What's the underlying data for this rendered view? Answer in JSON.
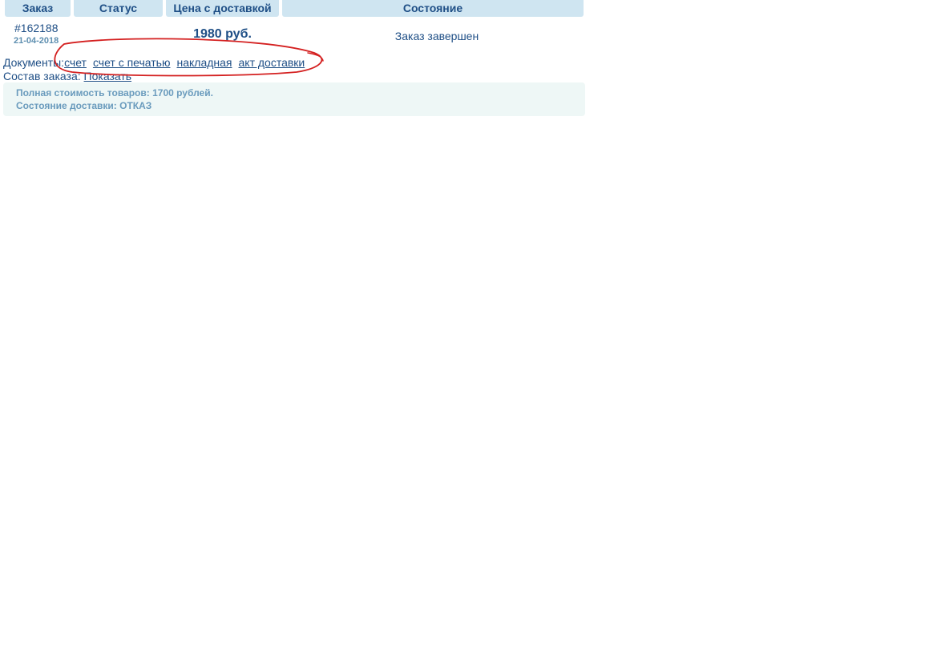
{
  "table": {
    "headers": {
      "order": "Заказ",
      "status": "Статус",
      "price": "Цена с доставкой",
      "state": "Состояние"
    },
    "row": {
      "order_number": "#162188",
      "order_date": "21-04-2018",
      "price": "1980 руб.",
      "state": "Заказ завершен"
    }
  },
  "documents": {
    "label": "Документы:",
    "links": [
      "счет",
      "счет с печатью",
      "накладная",
      "акт доставки"
    ]
  },
  "composition": {
    "label": "Состав заказа:",
    "show_link": "Показать"
  },
  "summary": {
    "total": "Полная стоимость товаров: 1700 рублей.",
    "delivery": "Состояние доставки: ОТКАЗ"
  },
  "colors": {
    "header_bg": "#cfe5f1",
    "text_primary": "#1f4f86",
    "summary_bg": "#eef7f6",
    "annotation": "#d42020"
  }
}
